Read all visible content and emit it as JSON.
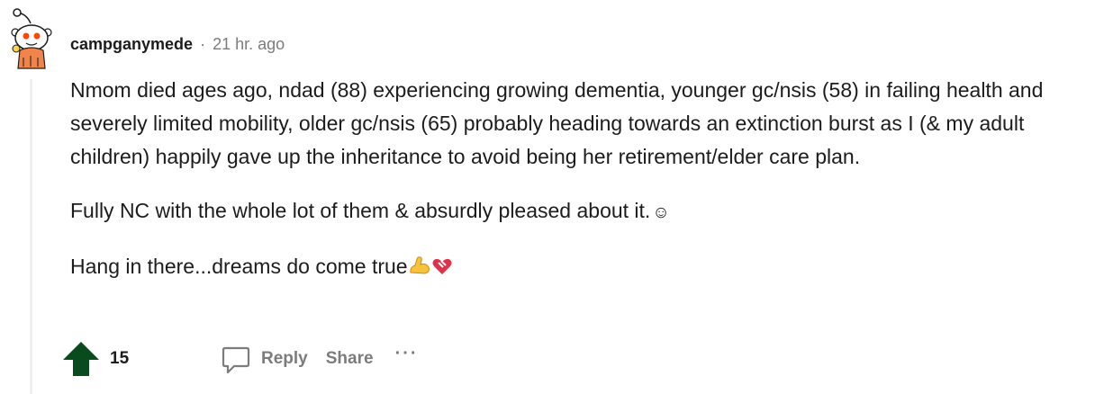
{
  "comment": {
    "author": "campganymede",
    "separator": "·",
    "time": "21 hr. ago",
    "paragraphs": [
      "Nmom died ages ago, ndad (88) experiencing growing dementia, younger gc/nsis (58) in failing health and severely limited mobility, older gc/nsis (65) probably heading towards an extinction burst as I (& my adult children) happily gave up the inheritance to avoid being her retirement/elder care plan.",
      "Fully NC with the whole lot of them & absurdly pleased about it.",
      "Hang in there...dreams do come true"
    ],
    "emoji": {
      "smile": "☺",
      "flexed_biceps": "flexed-biceps-icon",
      "heart": "mending-heart-icon"
    }
  },
  "actions": {
    "score": "15",
    "reply_label": "Reply",
    "share_label": "Share",
    "more_label": "···"
  },
  "colors": {
    "upvote_active": "#0a4b1e",
    "muted": "#7c7c7c",
    "text": "#1c1c1c",
    "thread_line": "#edeff1"
  }
}
